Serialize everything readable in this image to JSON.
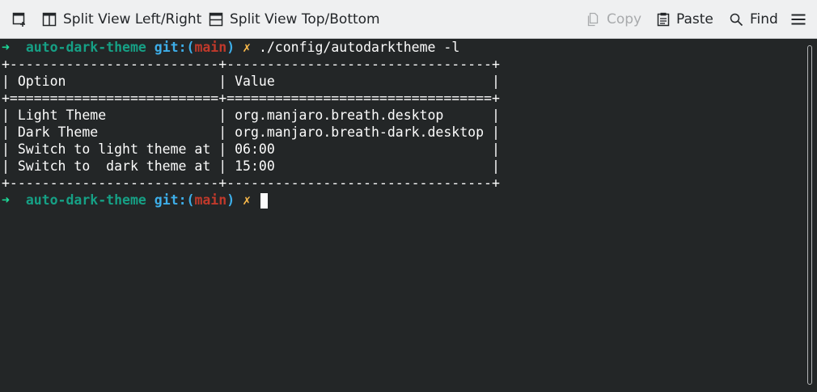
{
  "toolbar": {
    "split_lr_label": "Split View Left/Right",
    "split_tb_label": "Split View Top/Bottom",
    "copy_label": "Copy",
    "paste_label": "Paste",
    "find_label": "Find",
    "icons": {
      "new_tab": "new-tab-icon",
      "split_lr": "split-left-right-icon",
      "split_tb": "split-top-bottom-icon",
      "copy": "copy-icon",
      "paste": "paste-icon",
      "find": "search-icon",
      "menu": "hamburger-menu-icon"
    }
  },
  "terminal": {
    "prompt": {
      "arrow": "➜",
      "dir": "auto-dark-theme",
      "git_prefix": "git:(",
      "branch": "main",
      "git_suffix": ")",
      "dirty": "✗"
    },
    "command": "./config/autodarktheme -l",
    "output_lines": [
      "+--------------------------+---------------------------------+",
      "| Option                   | Value                           |",
      "+==========================+=================================+",
      "| Light Theme              | org.manjaro.breath.desktop      |",
      "| Dark Theme               | org.manjaro.breath-dark.desktop |",
      "| Switch to light theme at | 06:00                           |",
      "| Switch to  dark theme at | 15:00                           |",
      "+--------------------------+---------------------------------+"
    ]
  },
  "colors": {
    "terminal_bg": "#232627",
    "toolbar_bg": "#eff0f1",
    "prompt_arrow": "#1cdc9a",
    "prompt_dir": "#16a085",
    "git": "#3daee9",
    "branch": "#c0392b",
    "dirty": "#fdbc4b"
  }
}
